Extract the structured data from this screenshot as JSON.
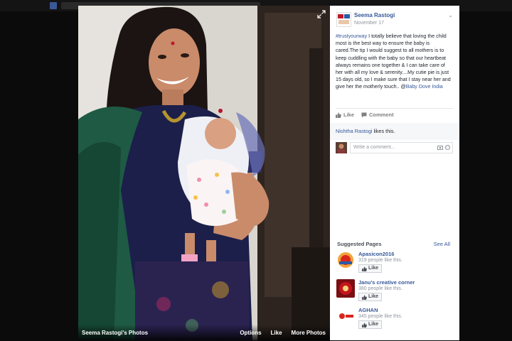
{
  "viewer": {
    "album_title": "Seema Rastogi's Photos",
    "actions": {
      "options": "Options",
      "like": "Like",
      "more_photos": "More Photos"
    }
  },
  "post": {
    "author": "Seema Rastogi",
    "date": "November 17",
    "hashtag": "#trustyourway",
    "body": " I totally believe that loving the child most is the best way to ensure the baby is cared.The tip I would suggest to all mothers is to keep cuddling with the baby so that our heartbeat always remains one together & I can take care of her with all my love & serenity....My cutie pie is just 15 days old, so I make sure that I stay near her and give her the motherly touch.. @",
    "mention": "Baby Dove India"
  },
  "post_actions": {
    "like": "Like",
    "comment": "Comment"
  },
  "likes": {
    "who": "Nishtha Rastogi",
    "suffix": " likes this."
  },
  "comment_box": {
    "placeholder": "Write a comment..."
  },
  "suggested": {
    "title": "Suggested Pages",
    "see_all": "See All",
    "pages": [
      {
        "name": "Apasicon2016",
        "count": "319 people like this.",
        "like": "Like"
      },
      {
        "name": "Janu's creative corner",
        "count": "380 people like this.",
        "like": "Like"
      },
      {
        "name": "AGHAN",
        "count": "345 people like this.",
        "like": "Like"
      }
    ]
  },
  "colors": {
    "link": "#365899",
    "panel_bg": "#ffffff",
    "backdrop": "#0b0b0b"
  },
  "icons": [
    "expand-icon",
    "thumbs-up-icon",
    "comment-bubble-icon",
    "camera-icon",
    "emoji-icon",
    "chevron-down-icon"
  ]
}
